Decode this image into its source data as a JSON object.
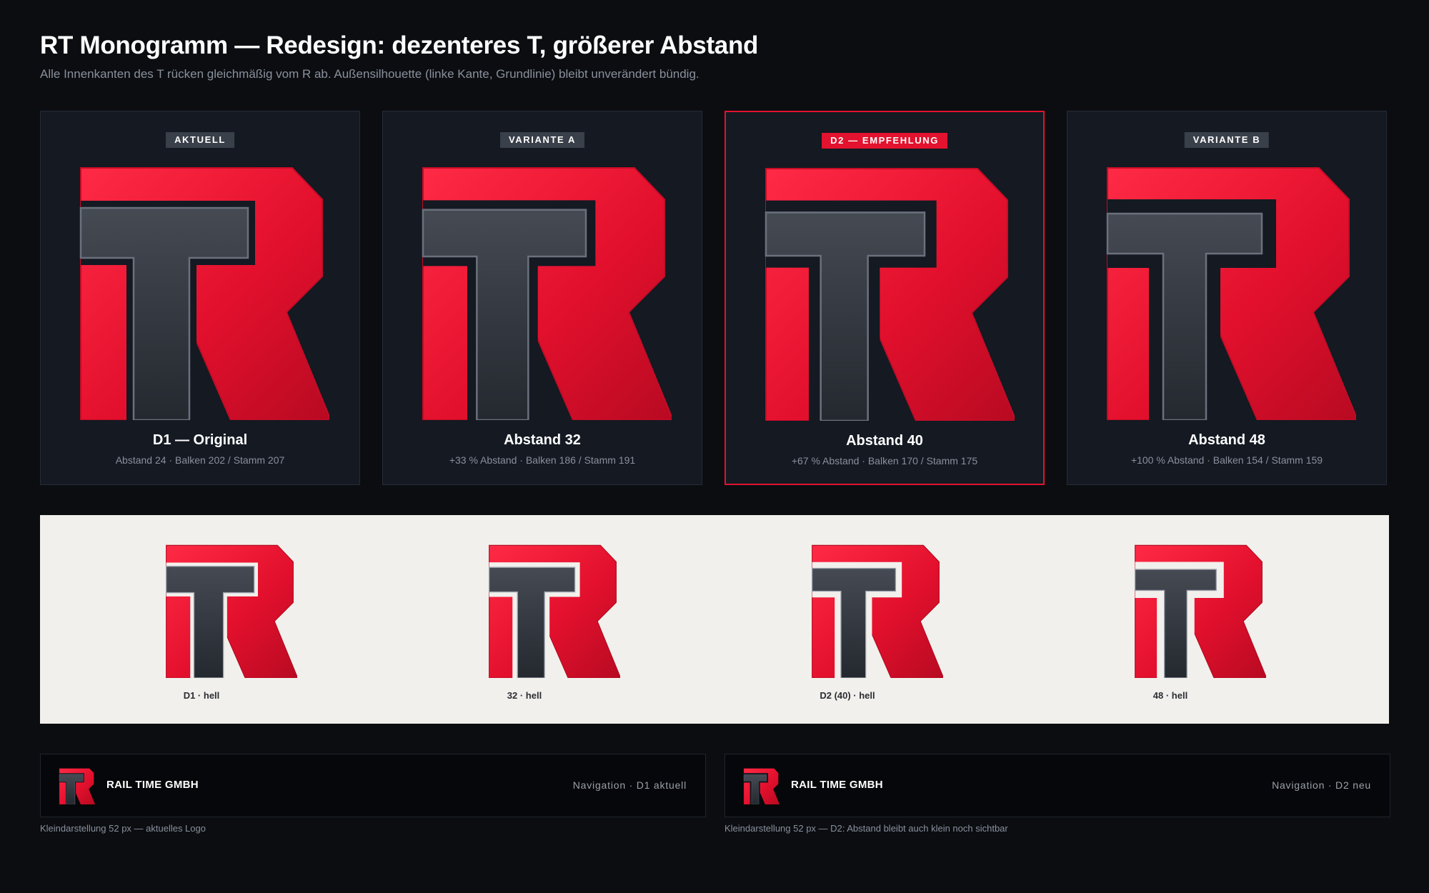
{
  "header": {
    "title": "RT Monogramm — Redesign: dezenteres T, größerer Abstand",
    "subtitle": "Alle Innenkanten des T rücken gleichmäßig vom R ab. Außensilhouette (linke Kante, Grundlinie) bleibt unverändert bündig."
  },
  "colors": {
    "background": "#0b0d11",
    "card_background": "#141922",
    "accent_red": "#e3122e",
    "t_gray": "#3a3f48",
    "light_strip": "#f2f0ec"
  },
  "cards": [
    {
      "badge": "AKTUELL",
      "name": "D1 — Original",
      "meta": "Abstand 24 · Balken 202 / Stamm 207",
      "highlighted": false,
      "gap": 24
    },
    {
      "badge": "VARIANTE A",
      "name": "Abstand 32",
      "meta": "+33 % Abstand · Balken 186 / Stamm 191",
      "highlighted": false,
      "gap": 32
    },
    {
      "badge": "D2 — EMPFEHLUNG",
      "name": "Abstand 40",
      "meta": "+67 % Abstand · Balken 170 / Stamm 175",
      "highlighted": true,
      "gap": 40
    },
    {
      "badge": "VARIANTE B",
      "name": "Abstand 48",
      "meta": "+100 % Abstand · Balken 154 / Stamm 159",
      "highlighted": false,
      "gap": 48
    }
  ],
  "light_row": [
    {
      "label": "D1 · hell",
      "gap": 24
    },
    {
      "label": "32 · hell",
      "gap": 32
    },
    {
      "label": "D2 (40) · hell",
      "gap": 40
    },
    {
      "label": "48 · hell",
      "gap": 48
    }
  ],
  "nav_previews": [
    {
      "brand": "RAIL TIME GMBH",
      "nav_text": "Navigation · D1 aktuell",
      "caption": "Kleindarstellung 52 px — aktuelles Logo",
      "gap": 24
    },
    {
      "brand": "RAIL TIME GMBH",
      "nav_text": "Navigation · D2 neu",
      "caption": "Kleindarstellung 52 px — D2: Abstand bleibt auch klein noch sichtbar",
      "gap": 40
    }
  ]
}
